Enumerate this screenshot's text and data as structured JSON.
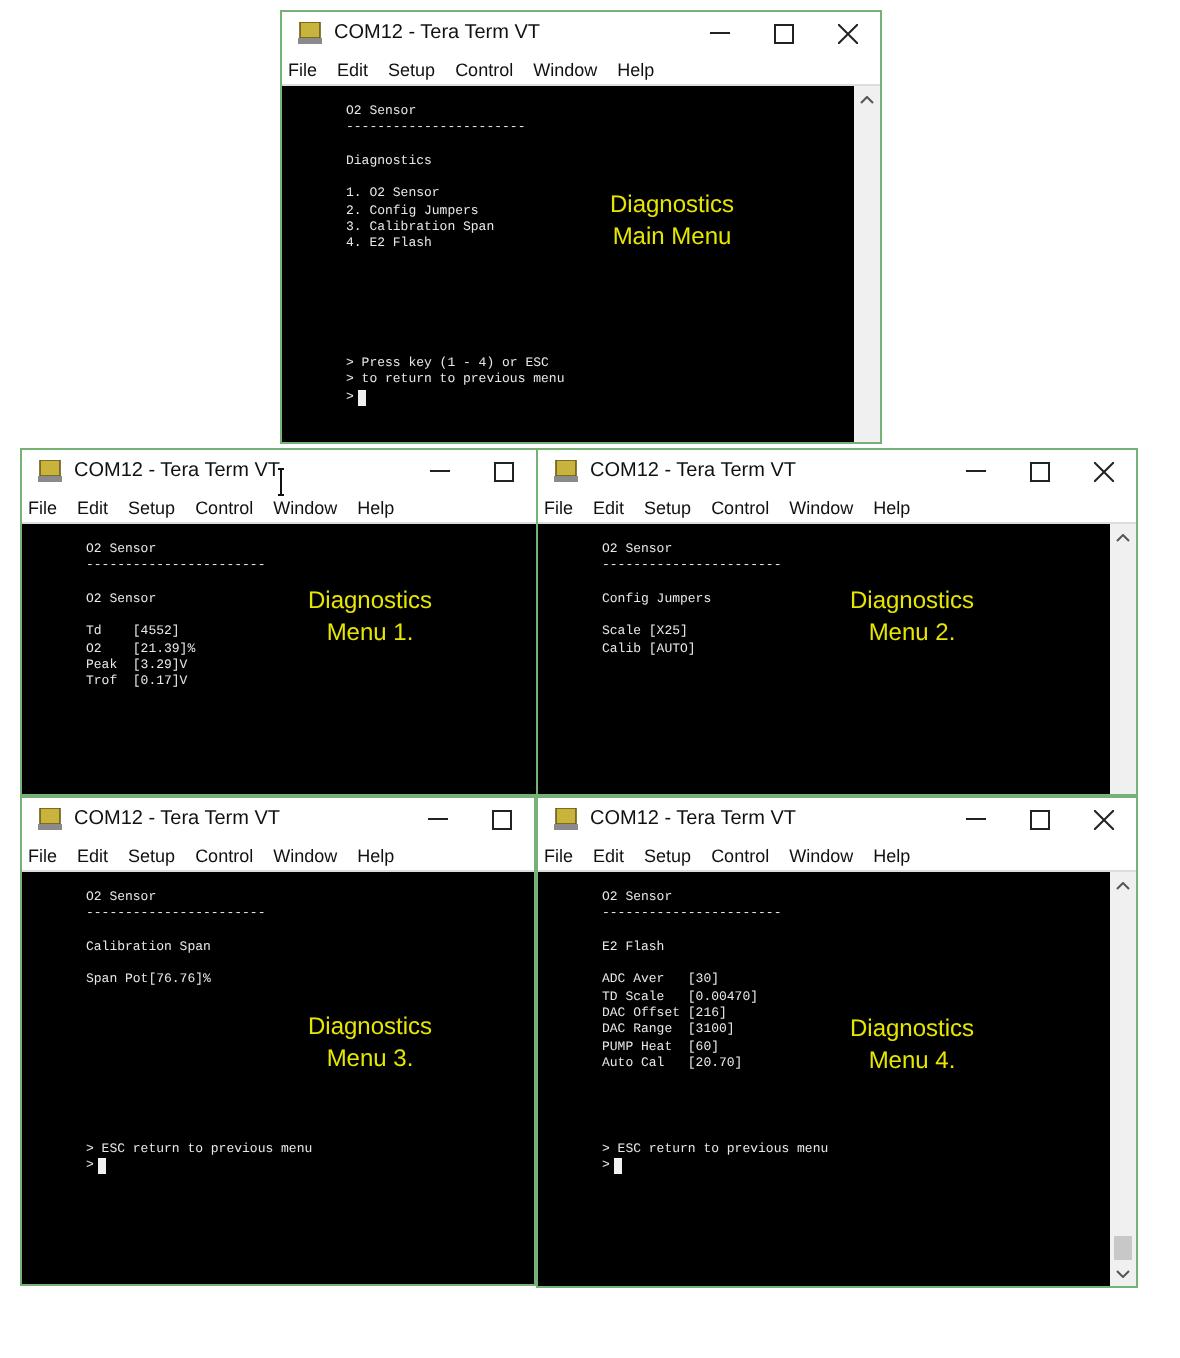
{
  "windows": [
    {
      "title": "COM12 - Tera Term VT",
      "buttons": [
        {
          "kind": "minimize"
        },
        {
          "kind": "maximize"
        },
        {
          "kind": "close"
        }
      ],
      "menu": [
        "File",
        "Edit",
        "Setup",
        "Control",
        "Window",
        "Help"
      ],
      "scrollbar": true,
      "scroll_thumb": false,
      "terminal": {
        "lines": [
          {
            "kind": "text",
            "text": "O2 Sensor"
          },
          {
            "kind": "text",
            "text": "-----------------------"
          },
          {
            "kind": "blank"
          },
          {
            "kind": "text",
            "text": "Diagnostics"
          },
          {
            "kind": "blank"
          },
          {
            "kind": "text",
            "text": "1. O2 Sensor"
          },
          {
            "kind": "text",
            "text": "2. Config Jumpers"
          },
          {
            "kind": "text",
            "text": "3. Calibration Span"
          },
          {
            "kind": "text",
            "text": "4. E2 Flash"
          }
        ],
        "footer": [
          {
            "kind": "text",
            "text": "> Press key (1 - 4) or ESC"
          },
          {
            "kind": "text",
            "text": "> to return to previous menu"
          },
          {
            "kind": "cursor",
            "text": ">"
          }
        ],
        "label": [
          "Diagnostics",
          "Main Menu"
        ]
      }
    },
    {
      "title": "COM12 - Tera Term VT",
      "buttons": [
        {
          "kind": "minimize"
        },
        {
          "kind": "maximize"
        }
      ],
      "menu": [
        "File",
        "Edit",
        "Setup",
        "Control",
        "Window",
        "Help"
      ],
      "terminal": {
        "lines": [
          {
            "kind": "text",
            "text": "O2 Sensor"
          },
          {
            "kind": "text",
            "text": "-----------------------"
          },
          {
            "kind": "blank"
          },
          {
            "kind": "text",
            "text": "O2 Sensor"
          },
          {
            "kind": "blank"
          },
          {
            "kind": "text",
            "text": "Td    [4552]"
          },
          {
            "kind": "text",
            "text": "O2    [21.39]%"
          },
          {
            "kind": "text",
            "text": "Peak  [3.29]V"
          },
          {
            "kind": "text",
            "text": "Trof  [0.17]V"
          }
        ],
        "label": [
          "Diagnostics",
          "Menu 1."
        ]
      }
    },
    {
      "title": "COM12 - Tera Term VT",
      "buttons": [
        {
          "kind": "minimize"
        },
        {
          "kind": "maximize"
        },
        {
          "kind": "close"
        }
      ],
      "menu": [
        "File",
        "Edit",
        "Setup",
        "Control",
        "Window",
        "Help"
      ],
      "scrollbar": true,
      "scroll_thumb": false,
      "terminal": {
        "lines": [
          {
            "kind": "text",
            "text": "O2 Sensor"
          },
          {
            "kind": "text",
            "text": "-----------------------"
          },
          {
            "kind": "blank"
          },
          {
            "kind": "text",
            "text": "Config Jumpers"
          },
          {
            "kind": "blank"
          },
          {
            "kind": "text",
            "text": "Scale [X25]"
          },
          {
            "kind": "text",
            "text": "Calib [AUTO]"
          }
        ],
        "label": [
          "Diagnostics",
          "Menu 2."
        ]
      }
    },
    {
      "title": "COM12 - Tera Term VT",
      "buttons": [
        {
          "kind": "minimize"
        },
        {
          "kind": "maximize"
        }
      ],
      "menu": [
        "File",
        "Edit",
        "Setup",
        "Control",
        "Window",
        "Help"
      ],
      "terminal": {
        "lines": [
          {
            "kind": "text",
            "text": "O2 Sensor"
          },
          {
            "kind": "text",
            "text": "-----------------------"
          },
          {
            "kind": "blank"
          },
          {
            "kind": "text",
            "text": "Calibration Span"
          },
          {
            "kind": "blank"
          },
          {
            "kind": "text",
            "text": "Span Pot[76.76]%"
          }
        ],
        "footer": [
          {
            "kind": "text",
            "text": "> ESC return to previous menu"
          },
          {
            "kind": "cursor",
            "text": ">"
          }
        ],
        "label": [
          "Diagnostics",
          "Menu 3."
        ]
      }
    },
    {
      "title": "COM12 - Tera Term VT",
      "buttons": [
        {
          "kind": "minimize"
        },
        {
          "kind": "maximize"
        },
        {
          "kind": "close"
        }
      ],
      "menu": [
        "File",
        "Edit",
        "Setup",
        "Control",
        "Window",
        "Help"
      ],
      "scrollbar": true,
      "scroll_thumb": true,
      "terminal": {
        "lines": [
          {
            "kind": "text",
            "text": "O2 Sensor"
          },
          {
            "kind": "text",
            "text": "-----------------------"
          },
          {
            "kind": "blank"
          },
          {
            "kind": "text",
            "text": "E2 Flash"
          },
          {
            "kind": "blank"
          },
          {
            "kind": "text",
            "text": "ADC Aver   [30]"
          },
          {
            "kind": "text",
            "text": "TD Scale   [0.00470]"
          },
          {
            "kind": "text",
            "text": "DAC Offset [216]"
          },
          {
            "kind": "text",
            "text": "DAC Range  [3100]"
          },
          {
            "kind": "text",
            "text": "PUMP Heat  [60]"
          },
          {
            "kind": "text",
            "text": "Auto Cal   [20.70]"
          }
        ],
        "footer": [
          {
            "kind": "text",
            "text": "> ESC return to previous menu"
          },
          {
            "kind": "cursor",
            "text": ">"
          }
        ],
        "label": [
          "Diagnostics",
          "Menu 4."
        ]
      }
    }
  ]
}
